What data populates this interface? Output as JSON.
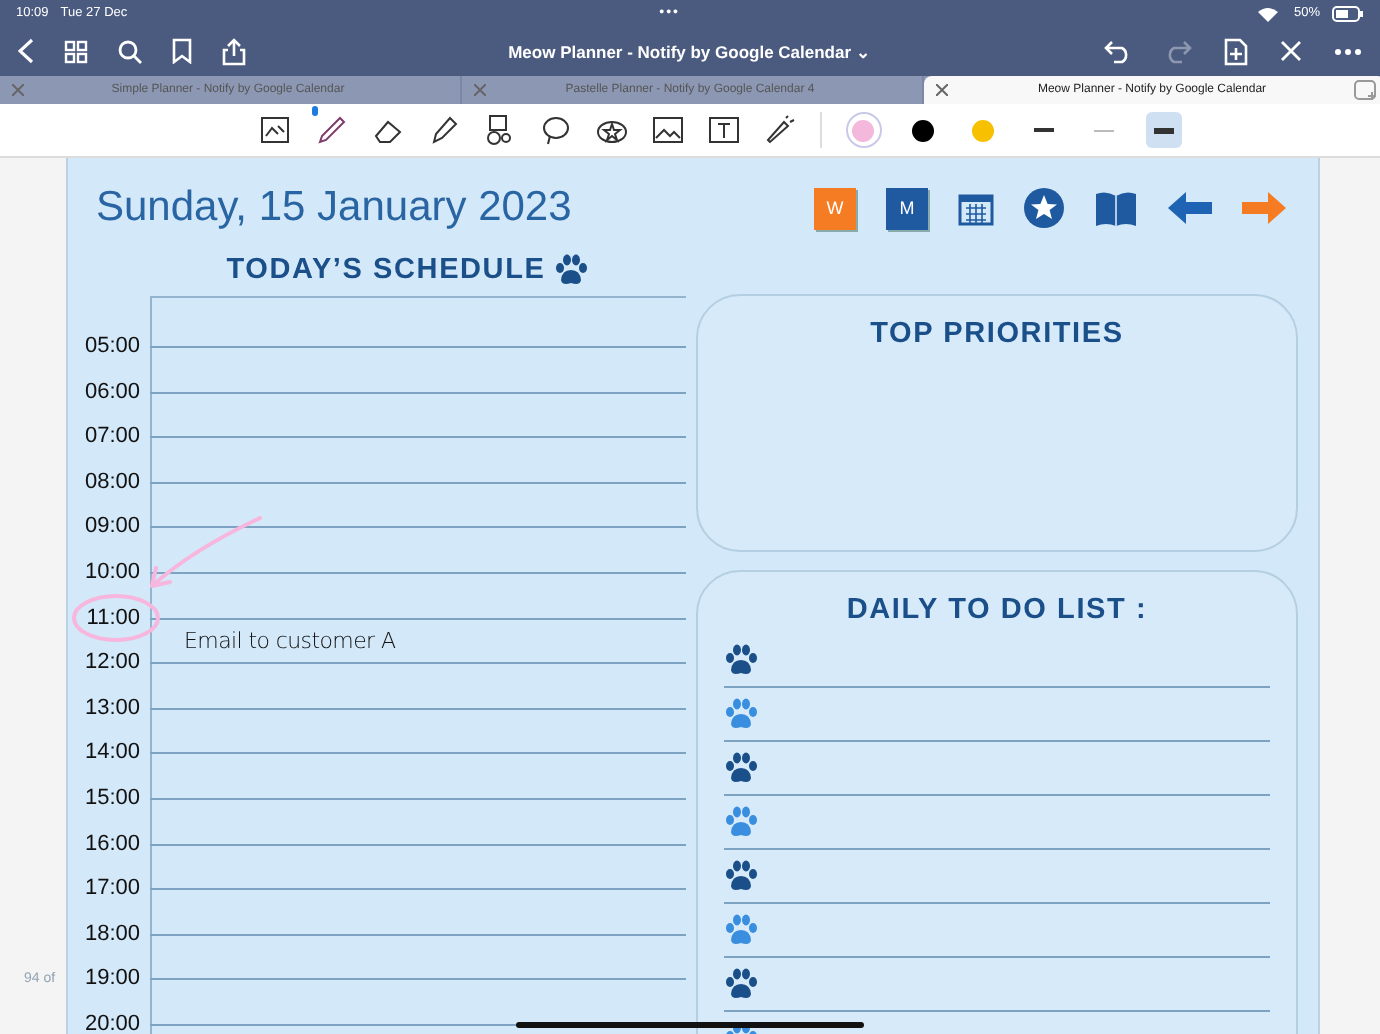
{
  "status_bar": {
    "time": "10:09",
    "date": "Tue 27 Dec",
    "battery": "50%"
  },
  "top_indicator": "•••",
  "window": {
    "title": "Meow Planner - Notify by Google Calendar",
    "caret": "⌄"
  },
  "tabs": [
    {
      "label": "Simple Planner - Notify by Google Calendar",
      "selected": false
    },
    {
      "label": "Pastelle Planner - Notify by Google Calendar 4",
      "selected": false
    },
    {
      "label": "Meow Planner - Notify by Google Calendar",
      "selected": true
    }
  ],
  "tools": [
    {
      "kind": "readmode",
      "selected": false
    },
    {
      "kind": "pen",
      "selected": true
    },
    {
      "kind": "eraser",
      "selected": false
    },
    {
      "kind": "highlighter",
      "selected": false
    },
    {
      "kind": "shapes",
      "selected": false
    },
    {
      "kind": "lasso",
      "selected": false
    },
    {
      "kind": "sticker",
      "selected": false
    },
    {
      "kind": "image",
      "selected": false
    },
    {
      "kind": "text",
      "selected": false
    },
    {
      "kind": "laser",
      "selected": false
    }
  ],
  "pen_colors": [
    {
      "color": "#f4b8dc",
      "selected": true
    },
    {
      "color": "#000000",
      "selected": false
    },
    {
      "color": "#f7c000",
      "selected": false
    }
  ],
  "pen_widths": [
    {
      "kind": "medium",
      "selected": false
    },
    {
      "kind": "thin",
      "selected": false
    },
    {
      "kind": "thick",
      "selected": true
    }
  ],
  "page_indicator": "94 of",
  "planner": {
    "date": "Sunday, 15 January 2023",
    "nav": [
      {
        "kind": "letter",
        "label": "W",
        "color": "#f57c22"
      },
      {
        "kind": "letter",
        "label": "M",
        "color": "#1f5aa0"
      },
      {
        "kind": "calendar"
      },
      {
        "kind": "star"
      },
      {
        "kind": "book"
      },
      {
        "kind": "back"
      },
      {
        "kind": "forward"
      }
    ],
    "schedule_title": "TODAY’S SCHEDULE",
    "hours": [
      {
        "time": "05:00"
      },
      {
        "time": "06:00"
      },
      {
        "time": "07:00"
      },
      {
        "time": "08:00"
      },
      {
        "time": "09:00"
      },
      {
        "time": "10:00"
      },
      {
        "time": "11:00",
        "entry": "Email to customer A"
      },
      {
        "time": "12:00"
      },
      {
        "time": "13:00"
      },
      {
        "time": "14:00"
      },
      {
        "time": "15:00"
      },
      {
        "time": "16:00"
      },
      {
        "time": "17:00"
      },
      {
        "time": "18:00"
      },
      {
        "time": "19:00"
      },
      {
        "time": "20:00"
      }
    ],
    "priorities_title": "TOP PRIORITIES",
    "todo_title": "DAILY TO DO LIST :",
    "todo": [
      {
        "color": "#1b4f8a"
      },
      {
        "color": "#3a8ee0"
      },
      {
        "color": "#1b4f8a"
      },
      {
        "color": "#3a8ee0"
      },
      {
        "color": "#1b4f8a"
      },
      {
        "color": "#3a8ee0"
      },
      {
        "color": "#1b4f8a"
      },
      {
        "color": "#3a8ee0"
      }
    ]
  }
}
